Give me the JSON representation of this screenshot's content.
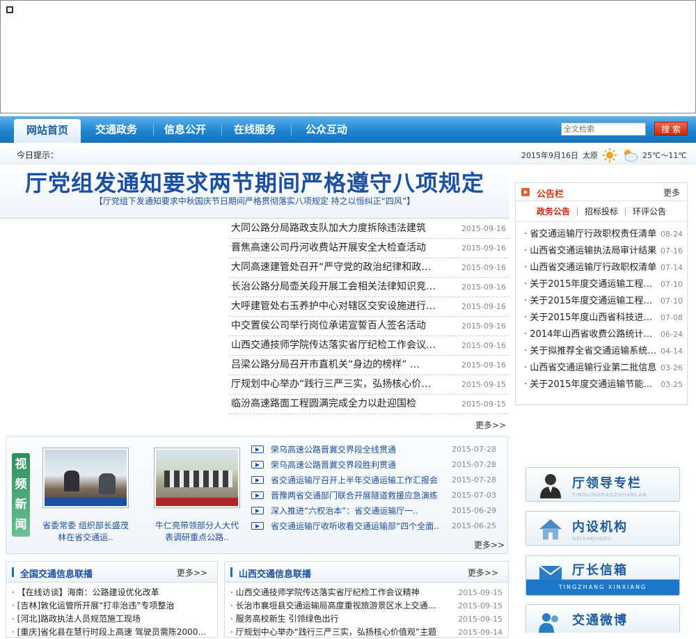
{
  "nav": {
    "tabs": [
      "网站首页",
      "交通政务",
      "信息公开",
      "在线服务",
      "公众互动"
    ],
    "search_placeholder": "全文检索",
    "search_button": "搜 索"
  },
  "tip": {
    "label": "今日提示：",
    "date": "2015年9月16日",
    "city": "太原",
    "temp": "25℃～11℃"
  },
  "headline": {
    "title": "厅党组发通知要求两节期间严格遵守八项规定",
    "subtitle": "【厅党组下发通知要求中秋国庆节日期间严格贯彻落实八项规定 持之以恒纠正“四风”】"
  },
  "news": [
    {
      "title": "大同公路分局路政支队加大力度拆除违法建筑",
      "date": "2015-09-16"
    },
    {
      "title": "晋焦高速公司丹河收费站开展安全大检查活动",
      "date": "2015-09-16"
    },
    {
      "title": "大同高速建管处召开“严守党的政治纪律和政治规矩",
      "date": "2015-09-16"
    },
    {
      "title": "长治公路分局壶关段开展工会相关法律知识竞赛活动",
      "date": "2015-09-16"
    },
    {
      "title": "大呼建管处右玉养护中心对辖区交安设施进行全面检查",
      "date": "2015-09-16"
    },
    {
      "title": "中交置侯公司举行岗位承诺宣誓百人签名活动",
      "date": "2015-09-16"
    },
    {
      "title": "山西交通技师学院传达落实省厅纪检工作会议精神",
      "date": "2015-09-16"
    },
    {
      "title": "吕梁公路分局召开市直机关“身边的榜样” …",
      "date": "2015-09-16"
    },
    {
      "title": "厅规划中心举办“践行三严三实，弘扬核心价值观”",
      "date": "2015-09-15"
    },
    {
      "title": "临汾高速路面工程圆满完成全力以赴迎国检",
      "date": "2015-09-15"
    }
  ],
  "more_label": "更多>>",
  "video": {
    "section_title": "视频新闻",
    "thumbs": [
      {
        "caption": "省委常委 组织部长盛茂林在省交通运.."
      },
      {
        "caption": "牛仁亮带领部分人大代表调研重点公路.."
      }
    ],
    "items": [
      {
        "title": "荣乌高速公路晋冀交界段全线贯通",
        "date": "2015-07-28"
      },
      {
        "title": "荣乌高速公路晋冀交界段胜利贯通",
        "date": "2015-07-28"
      },
      {
        "title": "省交通运输厅召开上半年交通运输工作汇报会",
        "date": "2015-07-28"
      },
      {
        "title": "晋豫两省交通部门联合开展隧道救援应急演练",
        "date": "2015-07-03"
      },
      {
        "title": "深入推进“六权治本”：省交通运输厅一..",
        "date": "2015-06-29"
      },
      {
        "title": "省交通运输厅收听收看交通运输部“四个全面..",
        "date": "2015-06-25"
      }
    ]
  },
  "national": {
    "title": "全国交通信息联播",
    "more": "更多>>",
    "items": [
      "【在线访谈】海南：公路建设优化改革",
      "[吉林]敦化运管所开展“打非治违”专项整治",
      "[河北]路政执法人员规范施工现场",
      "[重庆]省化县在慧行时段上高速 驾驶员需陈2000元罚"
    ]
  },
  "shanxi": {
    "title": "山西交通信息联播",
    "more": "更多>>",
    "items": [
      {
        "title": "山西交通技师学院传达落实省厅纪检工作会议精神",
        "date": "2015-09-15"
      },
      {
        "title": "长治市襄垣县交通运输局高度重视旅游景区水上交通安全",
        "date": "2015-09-15"
      },
      {
        "title": "服务高校新生 引领绿色出行",
        "date": "2015-09-15"
      },
      {
        "title": "厅规划中心举办“践行三严三实，弘扬核心价值观”主题",
        "date": "2015-09-14"
      }
    ]
  },
  "notice": {
    "title": "公告栏",
    "more": "更多",
    "tabs": [
      "政务公告",
      "招标投标",
      "环评公告"
    ],
    "items": [
      {
        "title": "省交通运输厅行政职权责任清单",
        "date": "08-24"
      },
      {
        "title": "山西省交通运输执法局审计结果",
        "date": "07-16"
      },
      {
        "title": "山西省交通运输厅行政职权清单",
        "date": "07-14"
      },
      {
        "title": "关于2015年度交通运输工程建设",
        "date": "07-10"
      },
      {
        "title": "关于2015年度交通运输工程建设",
        "date": "07-10"
      },
      {
        "title": "关于2015年度山西省科技进步奖",
        "date": "07-08"
      },
      {
        "title": "2014年山西省收费公路统计公报",
        "date": "06-24"
      },
      {
        "title": "关于拟推荐全省交通运输系统先进",
        "date": "04-14"
      },
      {
        "title": "山西省交通运输行业第二批信息",
        "date": "03-26"
      },
      {
        "title": "关于2015年度交通运输节能减排",
        "date": "03-25"
      }
    ]
  },
  "quick": [
    {
      "name": "厅领导专栏",
      "pinyin": "TINGLINGDAOZHUANLAN"
    },
    {
      "name": "内设机构",
      "pinyin": "NEISHEJIGOU"
    },
    {
      "name": "厅长信箱",
      "pinyin": "TINGZHANG XINXIANG"
    },
    {
      "name": "交通微博",
      "pinyin": ""
    }
  ]
}
